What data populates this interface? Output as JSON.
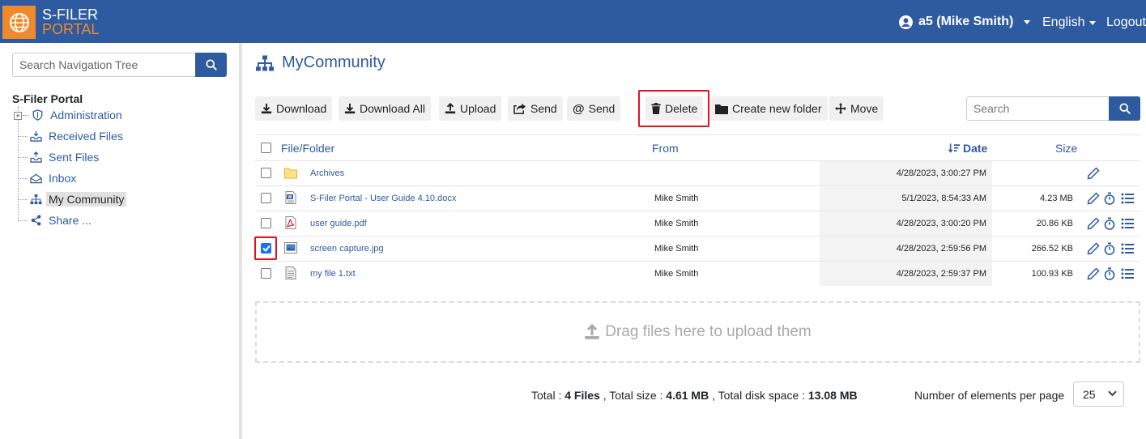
{
  "header": {
    "logo_line1": "S-FILER",
    "logo_line2": "PORTAL",
    "user": "a5 (Mike Smith)",
    "language": "English",
    "logout": "Logout",
    "brand_color": "#2e5aa0",
    "accent_color": "#f0892b"
  },
  "sidebar": {
    "search_placeholder": "Search Navigation Tree",
    "root": "S-Filer Portal",
    "items": [
      {
        "label": "Administration",
        "icon": "shield-icon"
      },
      {
        "label": "Received Files",
        "icon": "inbox-tray-icon"
      },
      {
        "label": "Sent Files",
        "icon": "outbox-tray-icon"
      },
      {
        "label": "Inbox",
        "icon": "envelope-icon"
      },
      {
        "label": "My Community",
        "icon": "sitemap-icon",
        "active": true
      },
      {
        "label": "Share ...",
        "icon": "share-icon"
      }
    ]
  },
  "main": {
    "title": "MyCommunity",
    "toolbar": {
      "download": "Download",
      "download_all": "Download All",
      "upload": "Upload",
      "send": "Send",
      "send_at": "Send",
      "delete": "Delete",
      "create_folder": "Create new folder",
      "move": "Move"
    },
    "search_placeholder": "Search",
    "columns": {
      "file": "File/Folder",
      "from": "From",
      "date": "Date",
      "size": "Size"
    },
    "rows": [
      {
        "name": "Archives",
        "type": "folder",
        "from": "",
        "date": "4/28/2023, 3:00:27 PM",
        "size": "",
        "checked": false
      },
      {
        "name": "S-Filer Portal - User Guide 4.10.docx",
        "type": "word",
        "from": "Mike Smith",
        "date": "5/1/2023, 8:54:33 AM",
        "size": "4.23 MB",
        "checked": false
      },
      {
        "name": "user guide.pdf",
        "type": "pdf",
        "from": "Mike Smith",
        "date": "4/28/2023, 3:00:20 PM",
        "size": "20.86 KB",
        "checked": false
      },
      {
        "name": "screen capture.jpg",
        "type": "image",
        "from": "Mike Smith",
        "date": "4/28/2023, 2:59:56 PM",
        "size": "266.52 KB",
        "checked": true
      },
      {
        "name": "my file 1.txt",
        "type": "text",
        "from": "Mike Smith",
        "date": "4/28/2023, 2:59:37 PM",
        "size": "100.93 KB",
        "checked": false
      }
    ],
    "dropzone": "Drag files here to upload them",
    "footer": {
      "total_label": "Total :",
      "total_files": "4 Files",
      "total_size_label": ", Total size :",
      "total_size": "4.61 MB",
      "disk_label": ", Total disk space :",
      "disk_space": "13.08 MB",
      "per_page_label": "Number of elements per page",
      "per_page_value": "25"
    }
  }
}
